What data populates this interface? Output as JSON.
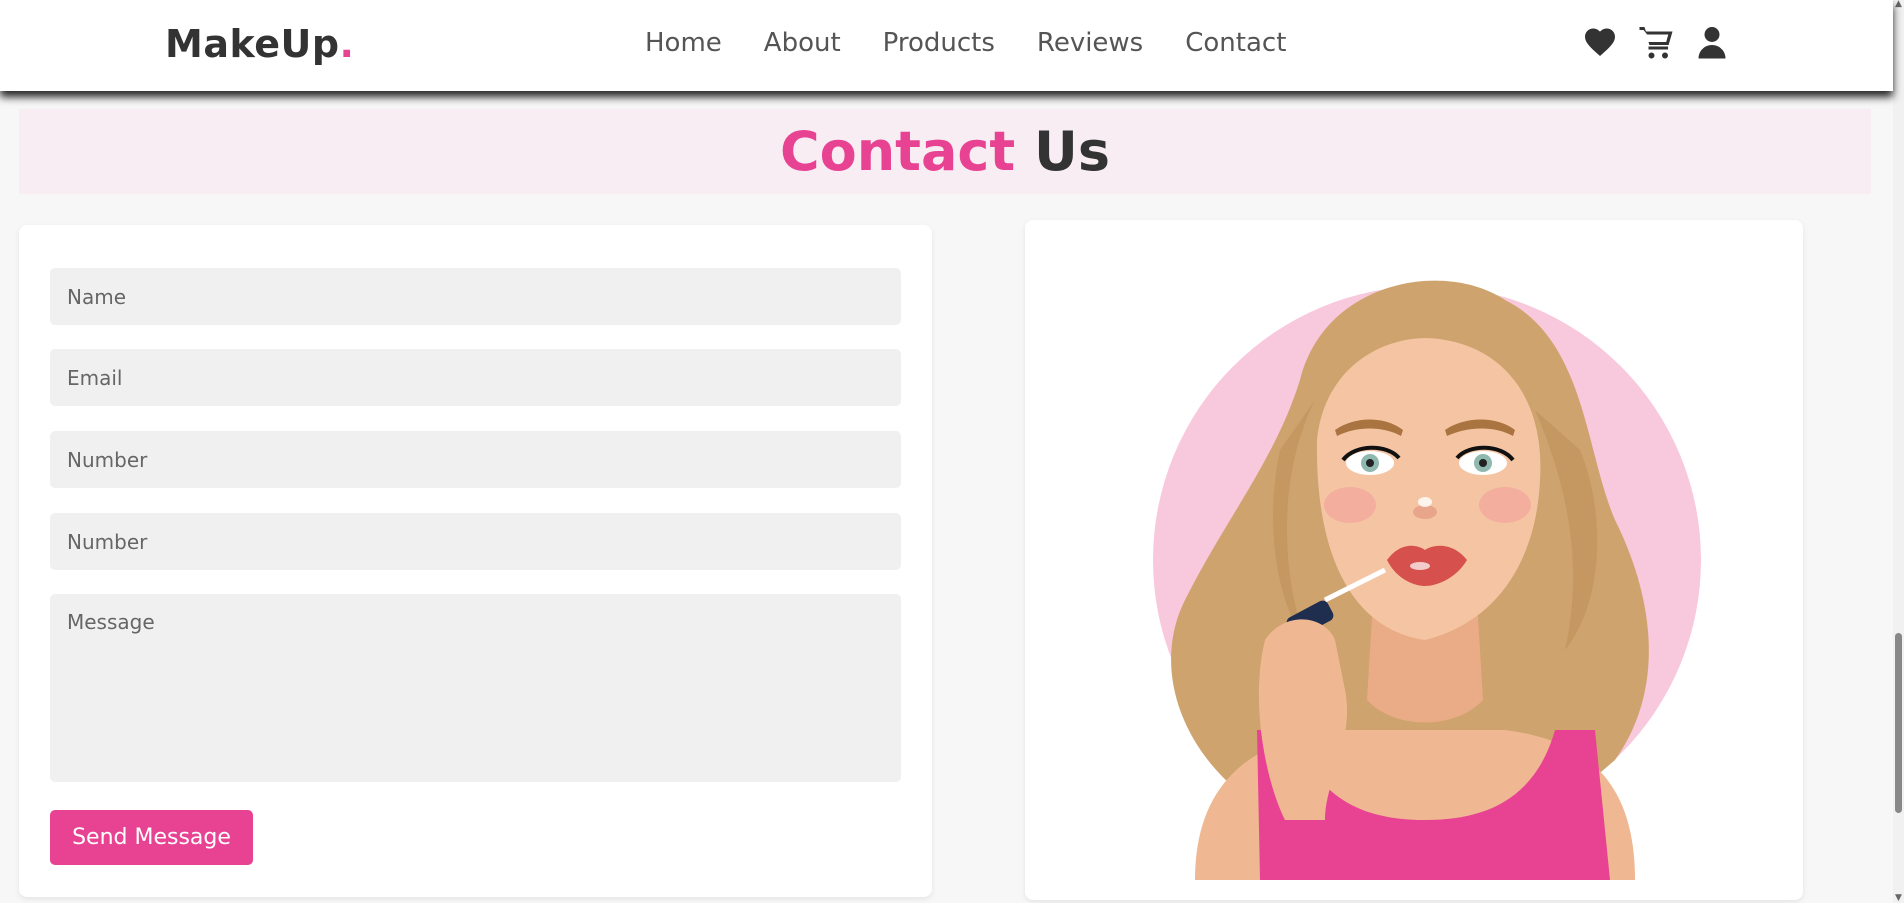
{
  "brand": {
    "name": "MakeUp",
    "dot": "."
  },
  "nav": {
    "items": [
      "Home",
      "About",
      "Products",
      "Reviews",
      "Contact"
    ]
  },
  "header_icons": [
    "heart-icon",
    "cart-icon",
    "user-icon"
  ],
  "section": {
    "title_pink": "Contact",
    "title_dark": "Us"
  },
  "form": {
    "name_placeholder": "Name",
    "email_placeholder": "Email",
    "number_placeholder": "Number",
    "number2_placeholder": "Number",
    "message_placeholder": "Message",
    "submit_label": "Send Message"
  },
  "colors": {
    "accent": "#e84393",
    "dark": "#333333",
    "banner_bg": "#f8edf3",
    "field_bg": "#f0f0f0"
  },
  "illustration": {
    "subject": "woman-applying-lip-gloss-illustration"
  }
}
